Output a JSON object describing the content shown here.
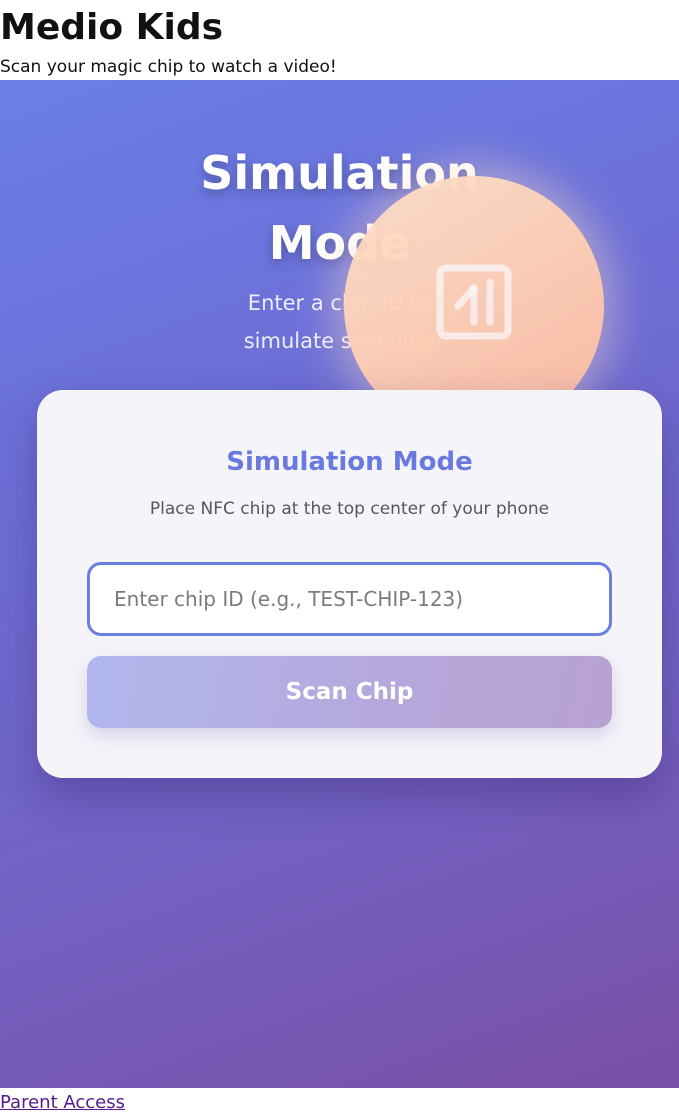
{
  "header": {
    "title": "Medio Kids",
    "subtitle": "Scan your magic chip to watch a video!"
  },
  "hero": {
    "title_line1": "Simulation",
    "title_line2": "Mode",
    "subtitle_line1": "Enter a chip ID to",
    "subtitle_line2": "simulate scanning",
    "orb_icon": "nfc-icon"
  },
  "card": {
    "title": "Simulation Mode",
    "hint": "Place NFC chip at the top center of your phone",
    "input": {
      "value": "",
      "placeholder": "Enter chip ID (e.g., TEST-CHIP-123)"
    },
    "scan_button_label": "Scan Chip"
  },
  "footer": {
    "parent_link": "Parent Access"
  },
  "colors": {
    "accent": "#6a79e0",
    "gradient_start": "#6a7fe8",
    "gradient_end": "#7a4fa6",
    "orb": "#ffcfb4",
    "link": "#551a8b"
  }
}
